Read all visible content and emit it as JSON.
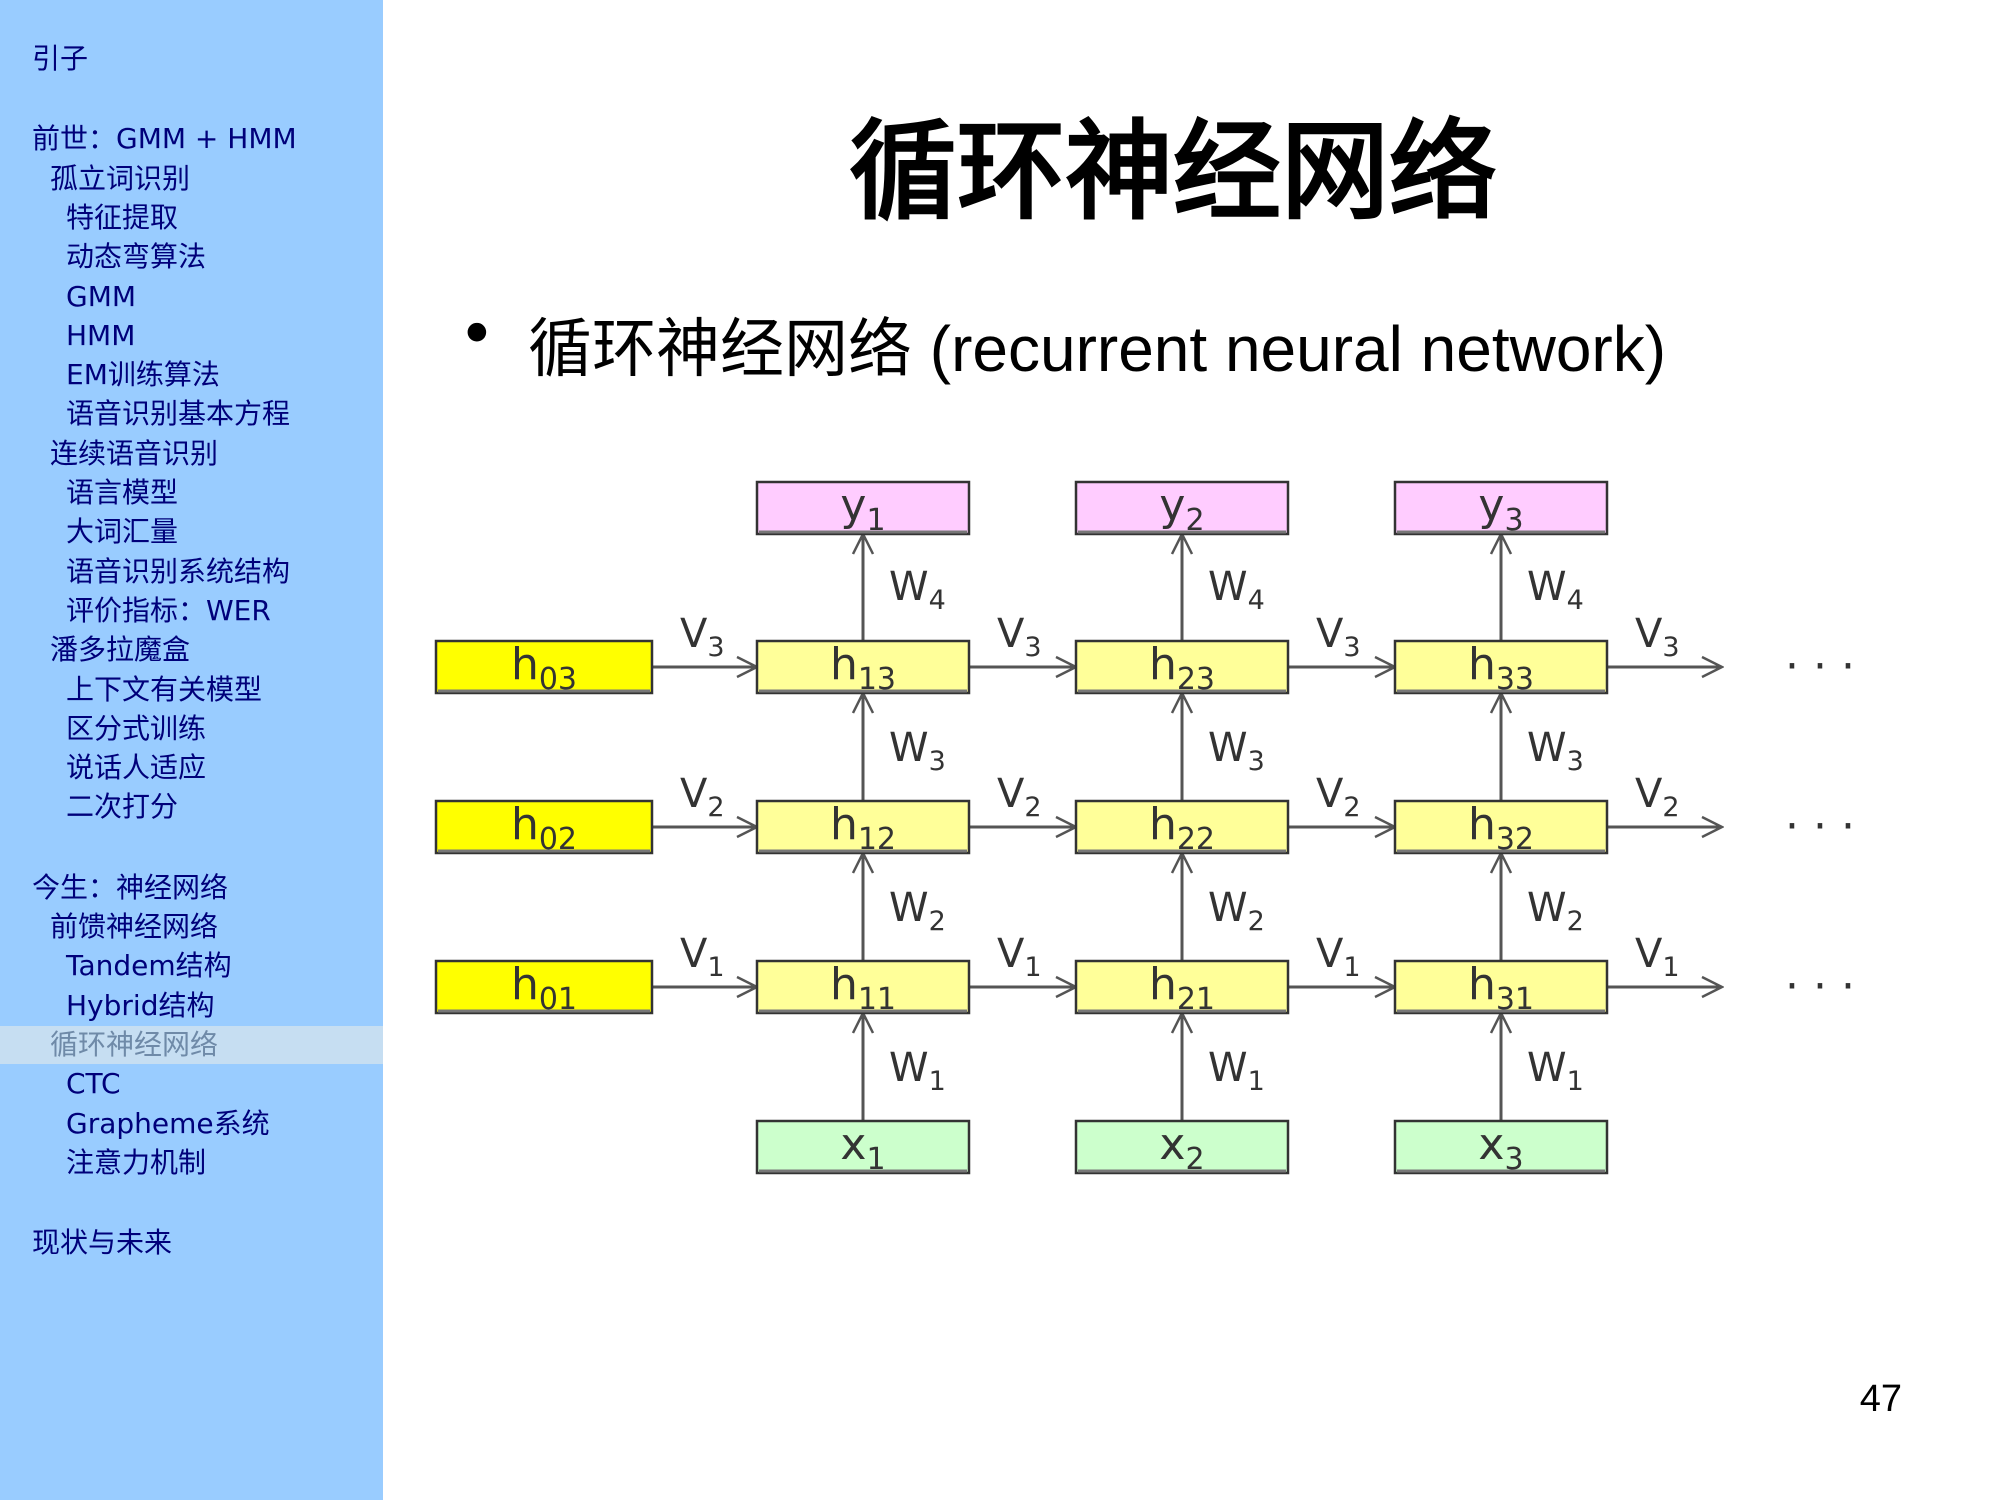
{
  "sidebar": {
    "items": [
      {
        "label": "引子",
        "indent": 0,
        "active": false
      },
      {
        "label": "前世：GMM + HMM",
        "indent": 0,
        "active": false
      },
      {
        "label": "孤立词识别",
        "indent": 1,
        "active": false
      },
      {
        "label": "特征提取",
        "indent": 2,
        "active": false
      },
      {
        "label": "动态弯算法",
        "indent": 2,
        "active": false
      },
      {
        "label": "GMM",
        "indent": 2,
        "active": false
      },
      {
        "label": "HMM",
        "indent": 2,
        "active": false
      },
      {
        "label": "EM训练算法",
        "indent": 2,
        "active": false
      },
      {
        "label": "语音识别基本方程",
        "indent": 2,
        "active": false
      },
      {
        "label": "连续语音识别",
        "indent": 1,
        "active": false
      },
      {
        "label": "语言模型",
        "indent": 2,
        "active": false
      },
      {
        "label": "大词汇量",
        "indent": 2,
        "active": false
      },
      {
        "label": "语音识别系统结构",
        "indent": 2,
        "active": false
      },
      {
        "label": "评价指标：WER",
        "indent": 2,
        "active": false
      },
      {
        "label": "潘多拉魔盒",
        "indent": 1,
        "active": false
      },
      {
        "label": "上下文有关模型",
        "indent": 2,
        "active": false
      },
      {
        "label": "区分式训练",
        "indent": 2,
        "active": false
      },
      {
        "label": "说话人适应",
        "indent": 2,
        "active": false
      },
      {
        "label": "二次打分",
        "indent": 2,
        "active": false
      },
      {
        "label": "今生：神经网络",
        "indent": 0,
        "active": false
      },
      {
        "label": "前馈神经网络",
        "indent": 1,
        "active": false
      },
      {
        "label": "Tandem结构",
        "indent": 2,
        "active": false
      },
      {
        "label": "Hybrid结构",
        "indent": 2,
        "active": false
      },
      {
        "label": "循环神经网络",
        "indent": 1,
        "active": true
      },
      {
        "label": "CTC",
        "indent": 2,
        "active": false
      },
      {
        "label": "Grapheme系统",
        "indent": 2,
        "active": false
      },
      {
        "label": "注意力机制",
        "indent": 2,
        "active": false
      },
      {
        "label": "现状与未来",
        "indent": 0,
        "active": false
      }
    ]
  },
  "slide": {
    "title": "循环神经网络",
    "bullet_symbol": "•",
    "bullet_text": "循环神经网络 (recurrent neural network)",
    "page_number": "47"
  },
  "diagram": {
    "colors": {
      "output": "#ffccff",
      "hidden": "#ffff99",
      "initial": "#ffff00",
      "input": "#ccffcc",
      "line": "#555555"
    },
    "outputs": [
      {
        "base": "y",
        "sub": "1"
      },
      {
        "base": "y",
        "sub": "2"
      },
      {
        "base": "y",
        "sub": "3"
      }
    ],
    "inputs": [
      {
        "base": "x",
        "sub": "1"
      },
      {
        "base": "x",
        "sub": "2"
      },
      {
        "base": "x",
        "sub": "3"
      }
    ],
    "initial_states": [
      {
        "base": "h",
        "sub": "03"
      },
      {
        "base": "h",
        "sub": "02"
      },
      {
        "base": "h",
        "sub": "01"
      }
    ],
    "hidden_rows": [
      [
        {
          "base": "h",
          "sub": "13"
        },
        {
          "base": "h",
          "sub": "23"
        },
        {
          "base": "h",
          "sub": "33"
        }
      ],
      [
        {
          "base": "h",
          "sub": "12"
        },
        {
          "base": "h",
          "sub": "22"
        },
        {
          "base": "h",
          "sub": "32"
        }
      ],
      [
        {
          "base": "h",
          "sub": "11"
        },
        {
          "base": "h",
          "sub": "21"
        },
        {
          "base": "h",
          "sub": "31"
        }
      ]
    ],
    "recurrent_weights": [
      {
        "base": "V",
        "sub": "3"
      },
      {
        "base": "V",
        "sub": "2"
      },
      {
        "base": "V",
        "sub": "1"
      }
    ],
    "vertical_weights": {
      "output": {
        "base": "W",
        "sub": "4"
      },
      "between_top": {
        "base": "W",
        "sub": "3"
      },
      "between_bottom": {
        "base": "W",
        "sub": "2"
      },
      "input": {
        "base": "W",
        "sub": "1"
      }
    },
    "continuation": "· · ·"
  }
}
